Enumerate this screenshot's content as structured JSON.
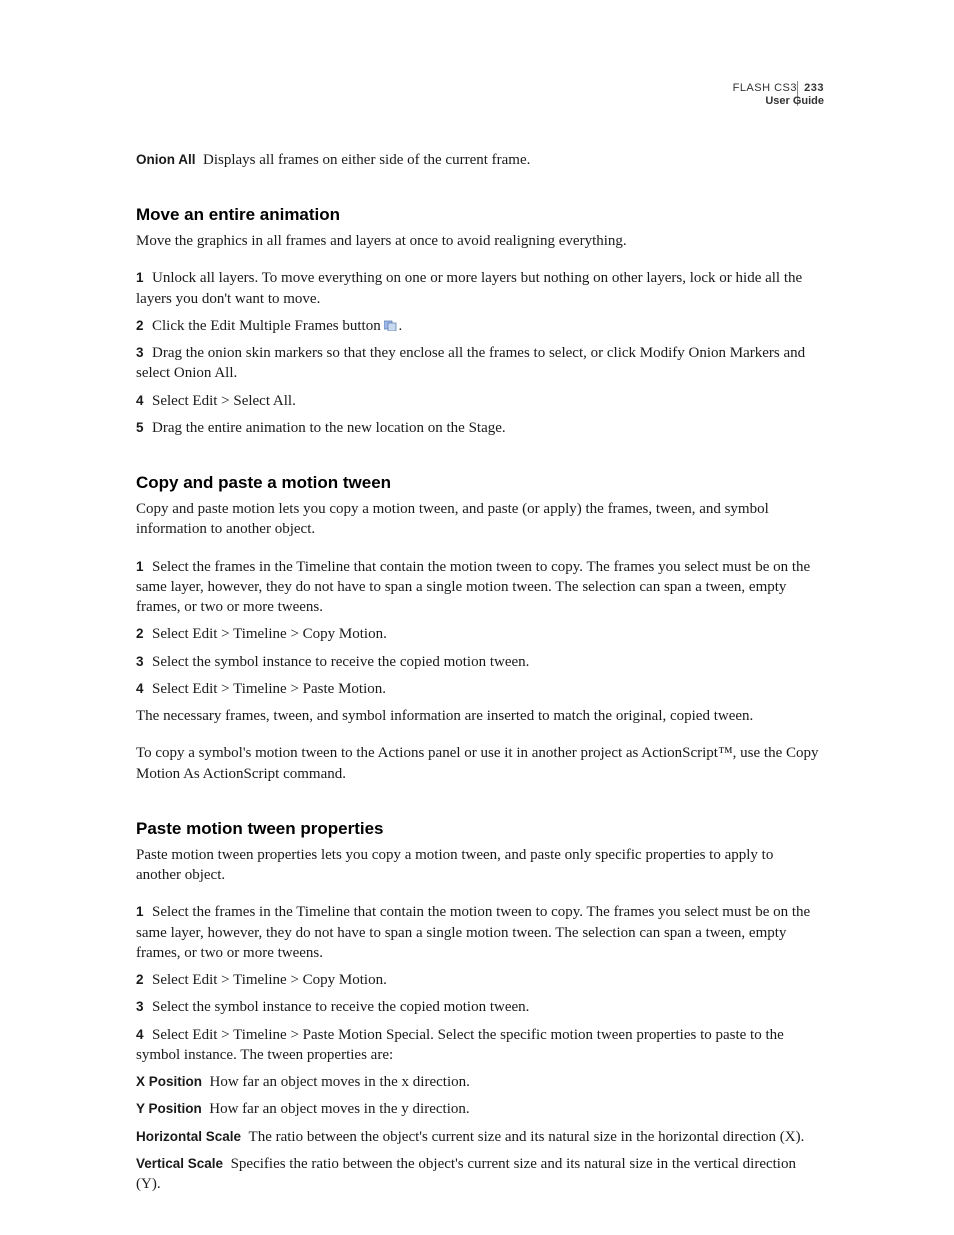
{
  "header": {
    "product": "FLASH CS3",
    "page_number": "233",
    "subtitle": "User Guide"
  },
  "intro": {
    "label": "Onion All",
    "text": "Displays all frames on either side of the current frame."
  },
  "section1": {
    "title": "Move an entire animation",
    "lead": "Move the graphics in all frames and layers at once to avoid realigning everything.",
    "s1": "Unlock all layers. To move everything on one or more layers but nothing on other layers, lock or hide all the layers you don't want to move.",
    "s2a": "Click the Edit Multiple Frames button ",
    "s2b": ".",
    "s3": "Drag the onion skin markers so that they enclose all the frames to select, or click Modify Onion Markers and select Onion All.",
    "s4": "Select Edit > Select All.",
    "s5": "Drag the entire animation to the new location on the Stage."
  },
  "section2": {
    "title": "Copy and paste a motion tween",
    "lead": "Copy and paste motion lets you copy a motion tween, and paste (or apply) the frames, tween, and symbol information to another object.",
    "s1": "Select the frames in the Timeline that contain the motion tween to copy. The frames you select must be on the same layer, however, they do not have to span a single motion tween. The selection can span a tween, empty frames, or two or more tweens.",
    "s2": "Select Edit > Timeline > Copy Motion.",
    "s3": "Select the symbol instance to receive the copied motion tween.",
    "s4": "Select Edit > Timeline > Paste Motion.",
    "p_after": "The necessary frames, tween, and symbol information are inserted to match the original, copied tween.",
    "p_after2": "To copy a symbol's motion tween to the Actions panel or use it in another project as ActionScript™, use the Copy Motion As ActionScript command."
  },
  "section3": {
    "title": "Paste motion tween properties",
    "lead": "Paste motion tween properties lets you copy a motion tween, and paste only specific properties to apply to another object.",
    "s1": "Select the frames in the Timeline that contain the motion tween to copy. The frames you select must be on the same layer, however, they do not have to span a single motion tween. The selection can span a tween, empty frames, or two or more tweens.",
    "s2": "Select Edit > Timeline > Copy Motion.",
    "s3": "Select the symbol instance to receive the copied motion tween.",
    "s4": "Select Edit > Timeline > Paste Motion Special. Select the specific motion tween properties to paste to the symbol instance. The tween properties are:",
    "props": {
      "x_label": "X Position",
      "x_text": "How far an object moves in the x direction.",
      "y_label": "Y Position",
      "y_text": "How far an object moves in the y direction.",
      "h_label": "Horizontal Scale",
      "h_text": "The ratio between the object's current size and its natural size in the horizontal direction (X).",
      "v_label": "Vertical Scale",
      "v_text": "Specifies the ratio between the object's current size and its natural size in the vertical direction (Y)."
    }
  }
}
